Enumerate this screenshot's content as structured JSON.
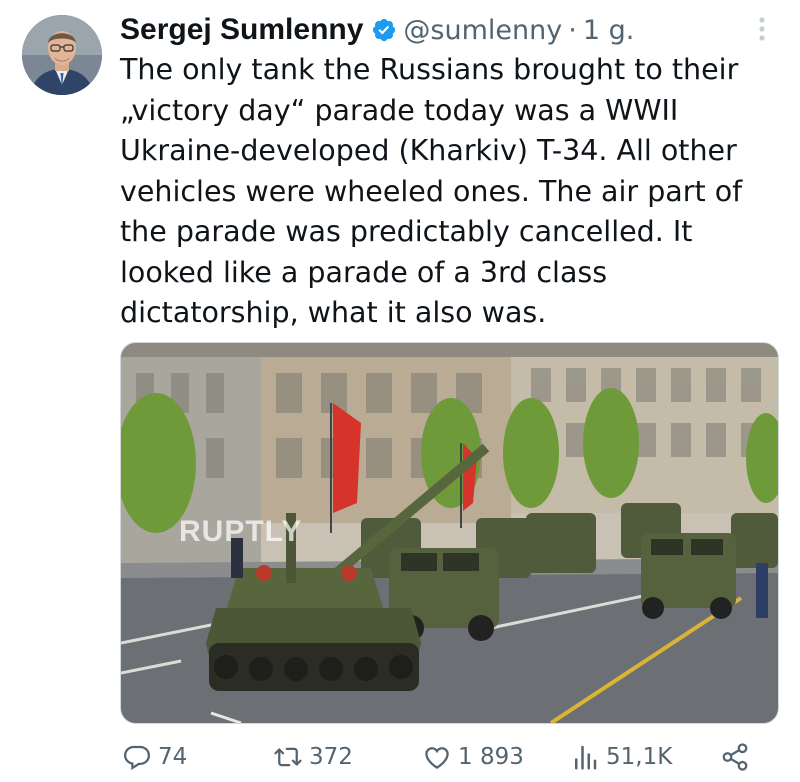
{
  "tweet": {
    "author_name": "Sergej Sumlenny",
    "handle": "@sumlenny",
    "separator": "·",
    "time": "1 g.",
    "text": "The only tank the Russians brought to their\n„victory day“ parade today was a WWII\nUkraine-developed (Kharkiv) T-34. All other\nvehicles were wheeled ones. The air part of\nthe parade was predictably cancelled. It\nlooked like a parade of a 3rd class\ndictatorship, what it also was.",
    "verified_color": "#1d9bf0"
  },
  "media": {
    "watermark": "RUPTLY"
  },
  "actions": {
    "replies": "74",
    "retweets": "372",
    "likes": "1 893",
    "views": "51,1K"
  },
  "icons": [
    "verified-badge-icon",
    "more-options-icon",
    "reply-icon",
    "retweet-icon",
    "like-icon",
    "views-icon",
    "share-icon"
  ]
}
